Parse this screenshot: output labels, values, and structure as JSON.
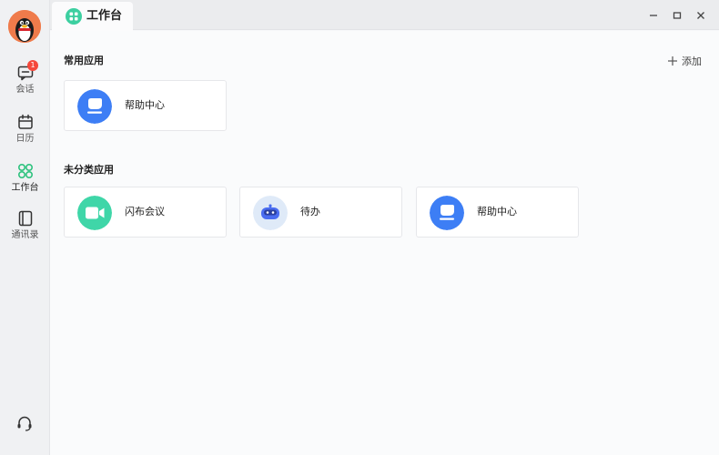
{
  "sidebar": {
    "badge_count": "1",
    "items": [
      {
        "label": "会话",
        "icon": "chat-icon"
      },
      {
        "label": "日历",
        "icon": "calendar-icon"
      },
      {
        "label": "工作台",
        "icon": "workbench-grid-icon"
      },
      {
        "label": "通讯录",
        "icon": "contacts-icon"
      }
    ],
    "support_icon": "headset-icon"
  },
  "titlebar": {
    "tab_label": "工作台",
    "controls": [
      "minimize-icon",
      "maximize-icon",
      "close-icon"
    ]
  },
  "colors": {
    "accent_green": "#2ec27e",
    "help_blue": "#3d7ef5",
    "meeting_green": "#3fd6a8",
    "todo_blue": "#4a6cf0",
    "badge_red": "#f5483b"
  },
  "common_apps": {
    "title": "常用应用",
    "add_label": "添加",
    "apps": [
      {
        "name": "帮助中心",
        "icon": "help-center-icon"
      }
    ]
  },
  "uncategorized_apps": {
    "title": "未分类应用",
    "apps": [
      {
        "name": "闪布会议",
        "icon": "video-meeting-icon"
      },
      {
        "name": "待办",
        "icon": "todo-robot-icon"
      },
      {
        "name": "帮助中心",
        "icon": "help-center-icon"
      }
    ]
  }
}
